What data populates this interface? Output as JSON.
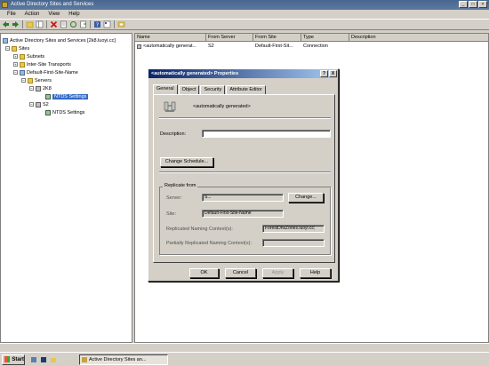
{
  "window": {
    "title": "Active Directory Sites and Services"
  },
  "menubar": {
    "items": [
      "File",
      "Action",
      "View",
      "Help"
    ]
  },
  "tree": {
    "root": "Active Directory Sites and Services [2k8.luoyi.cc]",
    "sites": "Sites",
    "subnets": "Subnets",
    "inter_site": "Inter-Site Transports",
    "default_site": "Default-First-Site-Name",
    "servers": "Servers",
    "server1": "2K8",
    "ntds1": "NTDS Settings",
    "server2": "S2",
    "ntds2": "NTDS Settings"
  },
  "list": {
    "columns": [
      "Name",
      "From Server",
      "From Site",
      "Type",
      "Description"
    ],
    "row": {
      "name": "<automatically generat...",
      "from_server": "S2",
      "from_site": "Default-First-Sit...",
      "type": "Connection",
      "description": ""
    }
  },
  "dialog": {
    "title": "<automatically generated> Properties",
    "help_glyph": "?",
    "close_glyph": "X",
    "tabs": [
      "General",
      "Object",
      "Security",
      "Attribute Editor"
    ],
    "object_name": "<automatically generated>",
    "description_label": "Description:",
    "description_value": "",
    "change_schedule": "Change Schedule...",
    "replicate_from": "Replicate from",
    "server_label": "Server:",
    "server_value": "S...",
    "change_button": "Change...",
    "site_label": "Site:",
    "site_value": "Default-First-Site-Name",
    "replicated_label": "Replicated Naming Context(s):",
    "replicated_value": "ForestDnsZones.luoyi.cc;",
    "partial_label": "Partially Replicated Naming Context(s):",
    "partial_value": "",
    "ok": "OK",
    "cancel": "Cancel",
    "apply": "Apply",
    "help": "Help"
  },
  "taskbar": {
    "start": "Start",
    "task": "Active Directory Sites an..."
  },
  "colors": {
    "title_bar": "#48668e",
    "dialog_title": "#0a246a",
    "selection": "#316ac5"
  }
}
